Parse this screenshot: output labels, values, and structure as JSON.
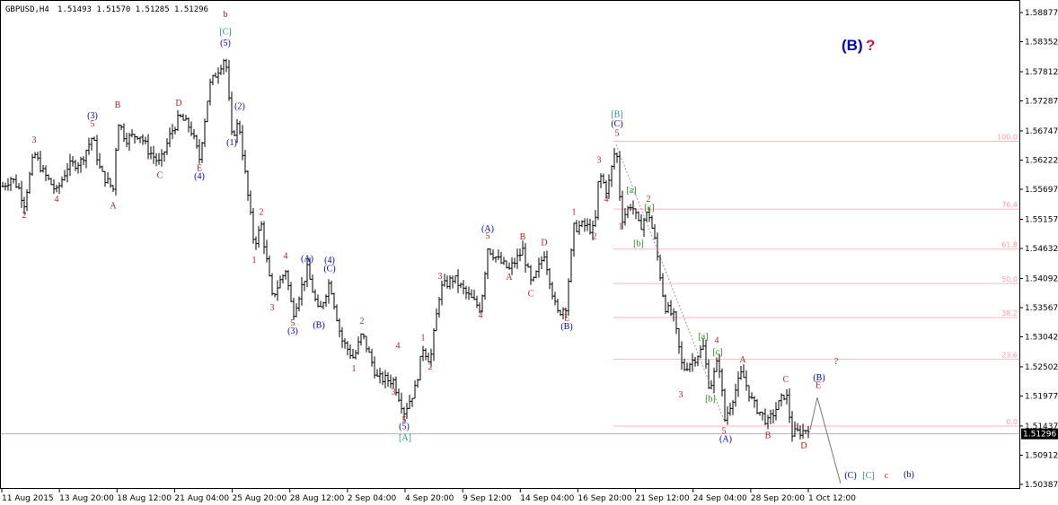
{
  "header": {
    "symbol": "GBPUSD,H4",
    "ohlc": "1.51493 1.51570 1.51285 1.51296"
  },
  "chart_data": {
    "type": "candlestick",
    "title": "GBPUSD,H4",
    "ylim": [
      1.50387,
      1.58877
    ],
    "y_ticks": [
      "1.58877",
      "1.58352",
      "1.57812",
      "1.57287",
      "1.56747",
      "1.56222",
      "1.55697",
      "1.55157",
      "1.54632",
      "1.54092",
      "1.53567",
      "1.53042",
      "1.52502",
      "1.51977",
      "1.51437",
      "1.50912",
      "1.50387"
    ],
    "x_ticks": [
      "11 Aug 2015",
      "13 Aug 20:00",
      "18 Aug 12:00",
      "21 Aug 04:00",
      "25 Aug 20:00",
      "28 Aug 12:00",
      "2 Sep 04:00",
      "4 Sep 20:00",
      "9 Sep 12:00",
      "14 Sep 04:00",
      "16 Sep 20:00",
      "21 Sep 12:00",
      "24 Sep 04:00",
      "28 Sep 20:00",
      "1 Oct 12:00"
    ],
    "current_price": "1.51296",
    "colors": {
      "bars": "#000000",
      "grid": "#ffb6c1",
      "wave_red": "#b22222",
      "wave_blue": "#0000cd",
      "wave_green": "#228b22",
      "wave_teal": "#2e8b8b"
    },
    "price_path": [
      {
        "x": 3,
        "y": 1.5575
      },
      {
        "x": 12,
        "y": 1.559
      },
      {
        "x": 20,
        "y": 1.5575
      },
      {
        "x": 27,
        "y": 1.5545
      },
      {
        "x": 38,
        "y": 1.5635
      },
      {
        "x": 48,
        "y": 1.56
      },
      {
        "x": 63,
        "y": 1.5565
      },
      {
        "x": 75,
        "y": 1.561
      },
      {
        "x": 90,
        "y": 1.562
      },
      {
        "x": 103,
        "y": 1.5665
      },
      {
        "x": 112,
        "y": 1.56
      },
      {
        "x": 126,
        "y": 1.557
      },
      {
        "x": 131,
        "y": 1.5695
      },
      {
        "x": 140,
        "y": 1.566
      },
      {
        "x": 155,
        "y": 1.567
      },
      {
        "x": 165,
        "y": 1.564
      },
      {
        "x": 178,
        "y": 1.5615
      },
      {
        "x": 190,
        "y": 1.567
      },
      {
        "x": 200,
        "y": 1.57
      },
      {
        "x": 212,
        "y": 1.568
      },
      {
        "x": 222,
        "y": 1.5625
      },
      {
        "x": 233,
        "y": 1.5755
      },
      {
        "x": 251,
        "y": 1.581
      },
      {
        "x": 258,
        "y": 1.5665
      },
      {
        "x": 266,
        "y": 1.569
      },
      {
        "x": 275,
        "y": 1.557
      },
      {
        "x": 283,
        "y": 1.547
      },
      {
        "x": 291,
        "y": 1.5505
      },
      {
        "x": 303,
        "y": 1.5375
      },
      {
        "x": 318,
        "y": 1.5425
      },
      {
        "x": 326,
        "y": 1.5345
      },
      {
        "x": 342,
        "y": 1.5425
      },
      {
        "x": 355,
        "y": 1.5345
      },
      {
        "x": 367,
        "y": 1.5405
      },
      {
        "x": 380,
        "y": 1.53
      },
      {
        "x": 394,
        "y": 1.5265
      },
      {
        "x": 403,
        "y": 1.531
      },
      {
        "x": 420,
        "y": 1.523
      },
      {
        "x": 438,
        "y": 1.5225
      },
      {
        "x": 450,
        "y": 1.517
      },
      {
        "x": 462,
        "y": 1.521
      },
      {
        "x": 471,
        "y": 1.5285
      },
      {
        "x": 479,
        "y": 1.526
      },
      {
        "x": 490,
        "y": 1.539
      },
      {
        "x": 505,
        "y": 1.541
      },
      {
        "x": 520,
        "y": 1.538
      },
      {
        "x": 535,
        "y": 1.5355
      },
      {
        "x": 543,
        "y": 1.5465
      },
      {
        "x": 556,
        "y": 1.544
      },
      {
        "x": 567,
        "y": 1.5425
      },
      {
        "x": 582,
        "y": 1.546
      },
      {
        "x": 592,
        "y": 1.5395
      },
      {
        "x": 606,
        "y": 1.5455
      },
      {
        "x": 620,
        "y": 1.5345
      },
      {
        "x": 630,
        "y": 1.536
      },
      {
        "x": 639,
        "y": 1.55
      },
      {
        "x": 650,
        "y": 1.5505
      },
      {
        "x": 662,
        "y": 1.5495
      },
      {
        "x": 667,
        "y": 1.56
      },
      {
        "x": 676,
        "y": 1.5565
      },
      {
        "x": 686,
        "y": 1.565
      },
      {
        "x": 692,
        "y": 1.5515
      },
      {
        "x": 703,
        "y": 1.5545
      },
      {
        "x": 712,
        "y": 1.55
      },
      {
        "x": 722,
        "y": 1.553
      },
      {
        "x": 730,
        "y": 1.547
      },
      {
        "x": 740,
        "y": 1.536
      },
      {
        "x": 750,
        "y": 1.534
      },
      {
        "x": 760,
        "y": 1.5245
      },
      {
        "x": 773,
        "y": 1.5265
      },
      {
        "x": 783,
        "y": 1.5285
      },
      {
        "x": 790,
        "y": 1.521
      },
      {
        "x": 800,
        "y": 1.5265
      },
      {
        "x": 807,
        "y": 1.5155
      },
      {
        "x": 826,
        "y": 1.524
      },
      {
        "x": 838,
        "y": 1.5185
      },
      {
        "x": 855,
        "y": 1.515
      },
      {
        "x": 875,
        "y": 1.5205
      },
      {
        "x": 882,
        "y": 1.513
      },
      {
        "x": 895,
        "y": 1.5135
      },
      {
        "x": 902,
        "y": 1.5145
      }
    ],
    "fib_levels": [
      {
        "label": "100.0",
        "value": 1.5656
      },
      {
        "label": "76.4",
        "value": 1.5534
      },
      {
        "label": "61.8",
        "value": 1.5462
      },
      {
        "label": "50.0",
        "value": 1.54
      },
      {
        "label": "38.2",
        "value": 1.5339
      },
      {
        "label": "23.6",
        "value": 1.5264
      },
      {
        "label": "0.0",
        "value": 1.51437
      }
    ],
    "projection": [
      {
        "x": 902,
        "y": 1.5137
      },
      {
        "x": 910,
        "y": 1.5195
      },
      {
        "x": 936,
        "y": 1.504
      }
    ],
    "wave_labels": [
      {
        "t": "b",
        "x": 251,
        "y": 1.588,
        "c": "red",
        "s": 17
      },
      {
        "t": "[C]",
        "x": 251,
        "y": 1.5848,
        "c": "teal",
        "s": 11
      },
      {
        "t": "(5)",
        "x": 251,
        "y": 1.5828,
        "c": "blue",
        "s": 10
      },
      {
        "t": "3",
        "x": 38,
        "y": 1.5654,
        "c": "red",
        "s": 10
      },
      {
        "t": "2",
        "x": 27,
        "y": 1.5518,
        "c": "red",
        "s": 10
      },
      {
        "t": "4",
        "x": 63,
        "y": 1.5547,
        "c": "red",
        "s": 10
      },
      {
        "t": "(3)",
        "x": 103,
        "y": 1.5697,
        "c": "blue",
        "s": 10
      },
      {
        "t": "5",
        "x": 103,
        "y": 1.5683,
        "c": "red",
        "s": 10
      },
      {
        "t": "A",
        "x": 126,
        "y": 1.5535,
        "c": "red",
        "s": 10
      },
      {
        "t": "B",
        "x": 131,
        "y": 1.5717,
        "c": "red",
        "s": 10
      },
      {
        "t": "C",
        "x": 178,
        "y": 1.559,
        "c": "red",
        "s": 10
      },
      {
        "t": "D",
        "x": 199,
        "y": 1.572,
        "c": "red",
        "s": 10
      },
      {
        "t": "E",
        "x": 222,
        "y": 1.5603,
        "c": "red",
        "s": 10
      },
      {
        "t": "(4)",
        "x": 222,
        "y": 1.5588,
        "c": "blue",
        "s": 10
      },
      {
        "t": "(2)",
        "x": 267,
        "y": 1.5714,
        "c": "blue",
        "s": 10
      },
      {
        "t": "(1)",
        "x": 258,
        "y": 1.5649,
        "c": "blue",
        "s": 10
      },
      {
        "t": "2",
        "x": 291,
        "y": 1.5524,
        "c": "red",
        "s": 10
      },
      {
        "t": "1",
        "x": 283,
        "y": 1.5437,
        "c": "red",
        "s": 10
      },
      {
        "t": "3",
        "x": 303,
        "y": 1.5352,
        "c": "red",
        "s": 10
      },
      {
        "t": "4",
        "x": 318,
        "y": 1.5445,
        "c": "red",
        "s": 10
      },
      {
        "t": "5",
        "x": 326,
        "y": 1.5324,
        "c": "red",
        "s": 10
      },
      {
        "t": "(3)",
        "x": 326,
        "y": 1.531,
        "c": "blue",
        "s": 10
      },
      {
        "t": "(A)",
        "x": 342,
        "y": 1.544,
        "c": "blue",
        "s": 10
      },
      {
        "t": "(4)",
        "x": 367,
        "y": 1.5437,
        "c": "blue",
        "s": 10
      },
      {
        "t": "(C)",
        "x": 367,
        "y": 1.5422,
        "c": "blue",
        "s": 10
      },
      {
        "t": "(B)",
        "x": 355,
        "y": 1.532,
        "c": "blue",
        "s": 10
      },
      {
        "t": "2",
        "x": 403,
        "y": 1.5328,
        "c": "red",
        "s": 10
      },
      {
        "t": "1",
        "x": 394,
        "y": 1.5242,
        "c": "red",
        "s": 10
      },
      {
        "t": "3",
        "x": 438,
        "y": 1.52,
        "c": "red",
        "s": 10
      },
      {
        "t": "4",
        "x": 443,
        "y": 1.5283,
        "c": "red",
        "s": 10
      },
      {
        "t": "5",
        "x": 450,
        "y": 1.515,
        "c": "red",
        "s": 10
      },
      {
        "t": "(5)",
        "x": 450,
        "y": 1.5138,
        "c": "blue",
        "s": 10
      },
      {
        "t": "[A]",
        "x": 451,
        "y": 1.5118,
        "c": "teal",
        "s": 11
      },
      {
        "t": "1",
        "x": 471,
        "y": 1.5298,
        "c": "red",
        "s": 10
      },
      {
        "t": "2",
        "x": 479,
        "y": 1.5245,
        "c": "red",
        "s": 10
      },
      {
        "t": "3",
        "x": 490,
        "y": 1.5408,
        "c": "red",
        "s": 10
      },
      {
        "t": "4",
        "x": 535,
        "y": 1.5338,
        "c": "red",
        "s": 10
      },
      {
        "t": "(A)",
        "x": 543,
        "y": 1.5494,
        "c": "blue",
        "s": 10
      },
      {
        "t": "5",
        "x": 543,
        "y": 1.5481,
        "c": "red",
        "s": 10
      },
      {
        "t": "A",
        "x": 567,
        "y": 1.5407,
        "c": "red",
        "s": 10
      },
      {
        "t": "B",
        "x": 582,
        "y": 1.5479,
        "c": "red",
        "s": 10
      },
      {
        "t": "C",
        "x": 591,
        "y": 1.5377,
        "c": "red",
        "s": 10
      },
      {
        "t": "D",
        "x": 606,
        "y": 1.5469,
        "c": "red",
        "s": 10
      },
      {
        "t": "E",
        "x": 631,
        "y": 1.5333,
        "c": "red",
        "s": 10
      },
      {
        "t": "(B)",
        "x": 631,
        "y": 1.5318,
        "c": "blue",
        "s": 10
      },
      {
        "t": "1",
        "x": 639,
        "y": 1.5524,
        "c": "red",
        "s": 10
      },
      {
        "t": "2",
        "x": 662,
        "y": 1.548,
        "c": "red",
        "s": 10
      },
      {
        "t": "3",
        "x": 667,
        "y": 1.5617,
        "c": "red",
        "s": 10
      },
      {
        "t": "4",
        "x": 675,
        "y": 1.5547,
        "c": "red",
        "s": 10
      },
      {
        "t": "[B]",
        "x": 687,
        "y": 1.57,
        "c": "teal",
        "s": 11
      },
      {
        "t": "(C)",
        "x": 687,
        "y": 1.5683,
        "c": "blue",
        "s": 10
      },
      {
        "t": "5",
        "x": 687,
        "y": 1.5666,
        "c": "red",
        "s": 10
      },
      {
        "t": "[a]",
        "x": 703,
        "y": 1.5563,
        "c": "green",
        "s": 11
      },
      {
        "t": "2",
        "x": 722,
        "y": 1.5547,
        "c": "red",
        "s": 10
      },
      {
        "t": "[c]",
        "x": 723,
        "y": 1.5532,
        "c": "green",
        "s": 11
      },
      {
        "t": "1",
        "x": 691,
        "y": 1.5498,
        "c": "red",
        "s": 10
      },
      {
        "t": "[b]",
        "x": 711,
        "y": 1.5467,
        "c": "green",
        "s": 11
      },
      {
        "t": "[a]",
        "x": 783,
        "y": 1.53,
        "c": "green",
        "s": 11
      },
      {
        "t": "4",
        "x": 798,
        "y": 1.5293,
        "c": "red",
        "s": 10
      },
      {
        "t": "[c]",
        "x": 799,
        "y": 1.5272,
        "c": "green",
        "s": 11
      },
      {
        "t": "A",
        "x": 827,
        "y": 1.5258,
        "c": "red",
        "s": 10
      },
      {
        "t": "3",
        "x": 758,
        "y": 1.5195,
        "c": "red",
        "s": 10
      },
      {
        "t": "[b]",
        "x": 791,
        "y": 1.5188,
        "c": "green",
        "s": 11
      },
      {
        "t": "C",
        "x": 875,
        "y": 1.5223,
        "c": "red",
        "s": 10
      },
      {
        "t": "(B)",
        "x": 912,
        "y": 1.5226,
        "c": "blue",
        "s": 10
      },
      {
        "t": "E",
        "x": 911,
        "y": 1.5212,
        "c": "red",
        "s": 10
      },
      {
        "t": "?",
        "x": 931,
        "y": 1.5255,
        "c": "red",
        "s": 15
      },
      {
        "t": "5",
        "x": 806,
        "y": 1.513,
        "c": "red",
        "s": 10
      },
      {
        "t": "(A)",
        "x": 808,
        "y": 1.5115,
        "c": "blue",
        "s": 10
      },
      {
        "t": "B",
        "x": 855,
        "y": 1.5122,
        "c": "red",
        "s": 10
      },
      {
        "t": "D",
        "x": 895,
        "y": 1.5103,
        "c": "red",
        "s": 10
      },
      {
        "t": "(C)",
        "x": 947,
        "y": 1.505,
        "c": "blue",
        "s": 10
      },
      {
        "t": "[C]",
        "x": 967,
        "y": 1.505,
        "c": "teal",
        "s": 11
      },
      {
        "t": "c",
        "x": 987,
        "y": 1.505,
        "c": "red",
        "s": 17
      },
      {
        "t": "(b)",
        "x": 1012,
        "y": 1.5052,
        "c": "blue",
        "s": 17
      }
    ],
    "corner_label": {
      "text": "(B)",
      "q": "?"
    }
  }
}
